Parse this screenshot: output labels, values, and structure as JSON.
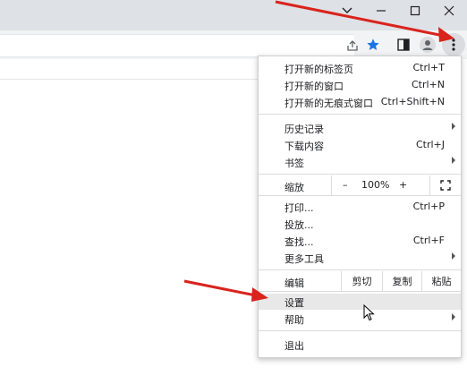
{
  "window": {
    "controls": {
      "minimize": "–",
      "maximize": "□",
      "close": "✕",
      "dropdown": "⌄"
    }
  },
  "menu": {
    "new_tab": {
      "label": "打开新的标签页",
      "shortcut": "Ctrl+T"
    },
    "new_window": {
      "label": "打开新的窗口",
      "shortcut": "Ctrl+N"
    },
    "new_incognito": {
      "label": "打开新的无痕式窗口",
      "shortcut": "Ctrl+Shift+N"
    },
    "history": {
      "label": "历史记录"
    },
    "downloads": {
      "label": "下载内容",
      "shortcut": "Ctrl+J"
    },
    "bookmarks": {
      "label": "书签"
    },
    "zoom": {
      "label": "缩放",
      "minus": "–",
      "value": "100%",
      "plus": "+"
    },
    "print": {
      "label": "打印...",
      "shortcut": "Ctrl+P"
    },
    "cast": {
      "label": "投放..."
    },
    "find": {
      "label": "查找...",
      "shortcut": "Ctrl+F"
    },
    "more_tools": {
      "label": "更多工具"
    },
    "edit": {
      "label": "编辑",
      "cut": "剪切",
      "copy": "复制",
      "paste": "粘贴"
    },
    "settings": {
      "label": "设置"
    },
    "help": {
      "label": "帮助"
    },
    "exit": {
      "label": "退出"
    }
  },
  "colors": {
    "accent_blue": "#1a73e8",
    "arrow_red": "#d9231d",
    "hover_bg": "#e8e8e8"
  }
}
